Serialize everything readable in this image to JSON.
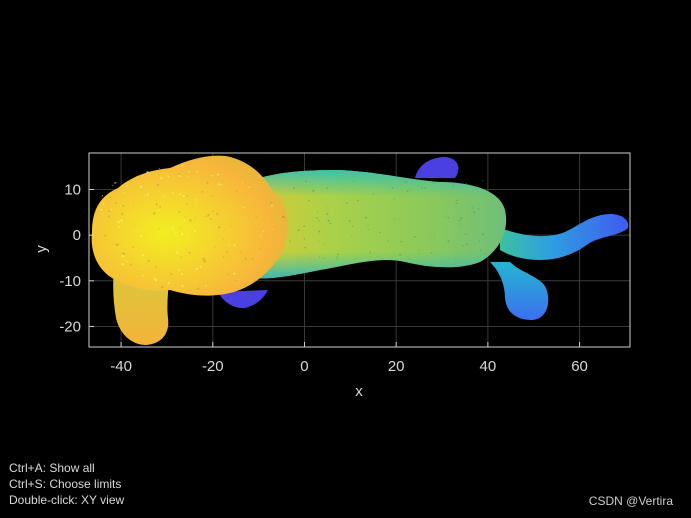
{
  "chart_data": {
    "type": "scatter",
    "title": "",
    "xlabel": "x",
    "ylabel": "y",
    "xlim": [
      -47,
      71
    ],
    "ylim": [
      -24.5,
      18
    ],
    "xticks": [
      -40,
      -20,
      0,
      20,
      40,
      60
    ],
    "yticks": [
      10,
      0,
      -10,
      -20
    ],
    "grid": true,
    "colormap": "parula",
    "colors": {
      "axes_bg": "#000000",
      "axes_line": "#cfcfcf",
      "grid": "#3a3a3a"
    }
  },
  "hints": [
    "Ctrl+A: Show all",
    "Ctrl+S: Choose limits",
    "Double-click: XY view"
  ],
  "watermark": "CSDN @Vertira"
}
